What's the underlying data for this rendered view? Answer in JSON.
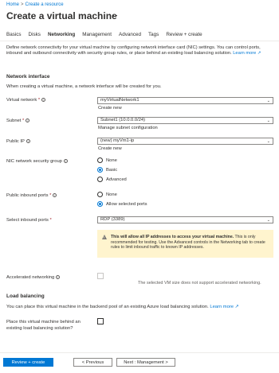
{
  "breadcrumb": {
    "home": "Home",
    "sep": ">",
    "create": "Create a resource"
  },
  "page": {
    "title": "Create a virtual machine",
    "more": "···"
  },
  "tabs": [
    "Basics",
    "Disks",
    "Networking",
    "Management",
    "Advanced",
    "Tags",
    "Review + create"
  ],
  "active_tab": "Networking",
  "description": {
    "text": "Define network connectivity for your virtual machine by configuring network interface card (NIC) settings. You can control ports, inbound and outbound connectivity with security group rules, or place behind an existing load balancing solution.",
    "learn_more": "Learn more ↗"
  },
  "network_interface": {
    "heading": "Network interface",
    "intro": "When creating a virtual machine, a network interface will be created for you.",
    "virtual_network": {
      "label": "Virtual network",
      "value": "myVirtualNetwork1",
      "link": "Create new"
    },
    "subnet": {
      "label": "Subnet",
      "value": "Subnet1 (10.0.0.0/24)",
      "link": "Manage subnet configuration"
    },
    "public_ip": {
      "label": "Public IP",
      "value": "(new) myVm1-ip",
      "link": "Create new"
    },
    "nsg": {
      "label": "NIC network security group",
      "options": [
        "None",
        "Basic",
        "Advanced"
      ],
      "selected": "Basic"
    },
    "inbound_ports": {
      "label": "Public inbound ports",
      "options": [
        "None",
        "Allow selected ports"
      ],
      "selected": "Allow selected ports"
    },
    "select_ports": {
      "label": "Select inbound ports",
      "value": "RDP (3389)"
    },
    "warning": {
      "bold": "This will allow all IP addresses to access your virtual machine.",
      "rest": " This is only recommended for testing.  Use the Advanced controls in the Networking tab to create rules to limit inbound traffic to known IP addresses."
    },
    "accelerated": {
      "label": "Accelerated networking",
      "note": "The selected VM size does not support accelerated networking."
    }
  },
  "load_balancing": {
    "heading": "Load balancing",
    "text": "You can place this virtual machine in the backend pool of an existing Azure load balancing solution.",
    "learn_more": "Learn more ↗",
    "question": {
      "line1": "Place this virtual machine behind an",
      "line2": "existing load balancing solution?"
    }
  },
  "footer": {
    "review": "Review + create",
    "previous": "< Previous",
    "next": "Next : Management >"
  },
  "colors": {
    "accent": "#0078d4",
    "warning_bg": "#fff4ce",
    "required": "#a4262c"
  }
}
